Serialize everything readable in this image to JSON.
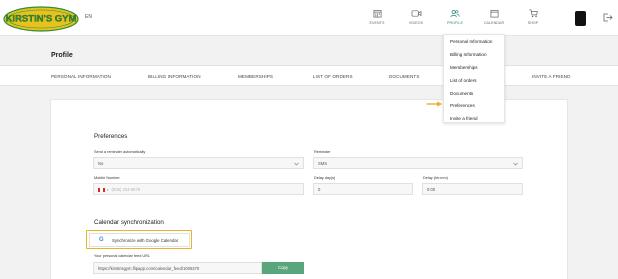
{
  "header": {
    "logo_text": "KIRSTIN'S GYM",
    "language": "EN",
    "nav": [
      {
        "label": "EVENTS",
        "icon": "calendar-grid-icon"
      },
      {
        "label": "VIDEOS",
        "icon": "video-camera-icon"
      },
      {
        "label": "PROFILE",
        "icon": "users-icon"
      },
      {
        "label": "CALENDAR",
        "icon": "calendar-icon"
      },
      {
        "label": "SHOP",
        "icon": "cart-icon"
      }
    ],
    "active_color": "#2a8a7a"
  },
  "page": {
    "title": "Profile",
    "tabs": [
      "PERSONAL INFORMATION",
      "BILLING INFORMATION",
      "MEMBERSHIPS",
      "LIST OF ORDERS",
      "DOCUMENTS",
      "INVITE A FRIEND"
    ]
  },
  "profile_menu": {
    "items": [
      "Personal Information",
      "Billing Information",
      "Memberships",
      "List of orders",
      "Documents",
      "Preferences",
      "Invite a friend"
    ],
    "highlighted": "Preferences"
  },
  "preferences": {
    "title": "Preferences",
    "send_reminder": {
      "label": "Send a reminder automatically",
      "value": "No"
    },
    "reminder": {
      "label": "Reminder",
      "value": "SMS"
    },
    "mobile": {
      "label": "Mobile Number",
      "placeholder": "(506) 234-5678"
    },
    "delay_days": {
      "label": "Delay day(s)",
      "value": "0"
    },
    "delay_hhmm": {
      "label": "Delay (hh:mm)",
      "value": "0:00"
    }
  },
  "calendar_sync": {
    "title": "Calendar synchronization",
    "google_button": "Synchronize with Google Calendar",
    "feed_label": "Your personal calendar feed URL",
    "feed_url": "https://kirstinsgym.flipapp.com/calendar_feed/1006370",
    "copy_button": "Copy"
  },
  "colors": {
    "highlight": "#e8b22a",
    "copy_button": "#5ba57c",
    "logo_green": "#2f8f3a",
    "logo_yellow": "#e7c21f"
  }
}
